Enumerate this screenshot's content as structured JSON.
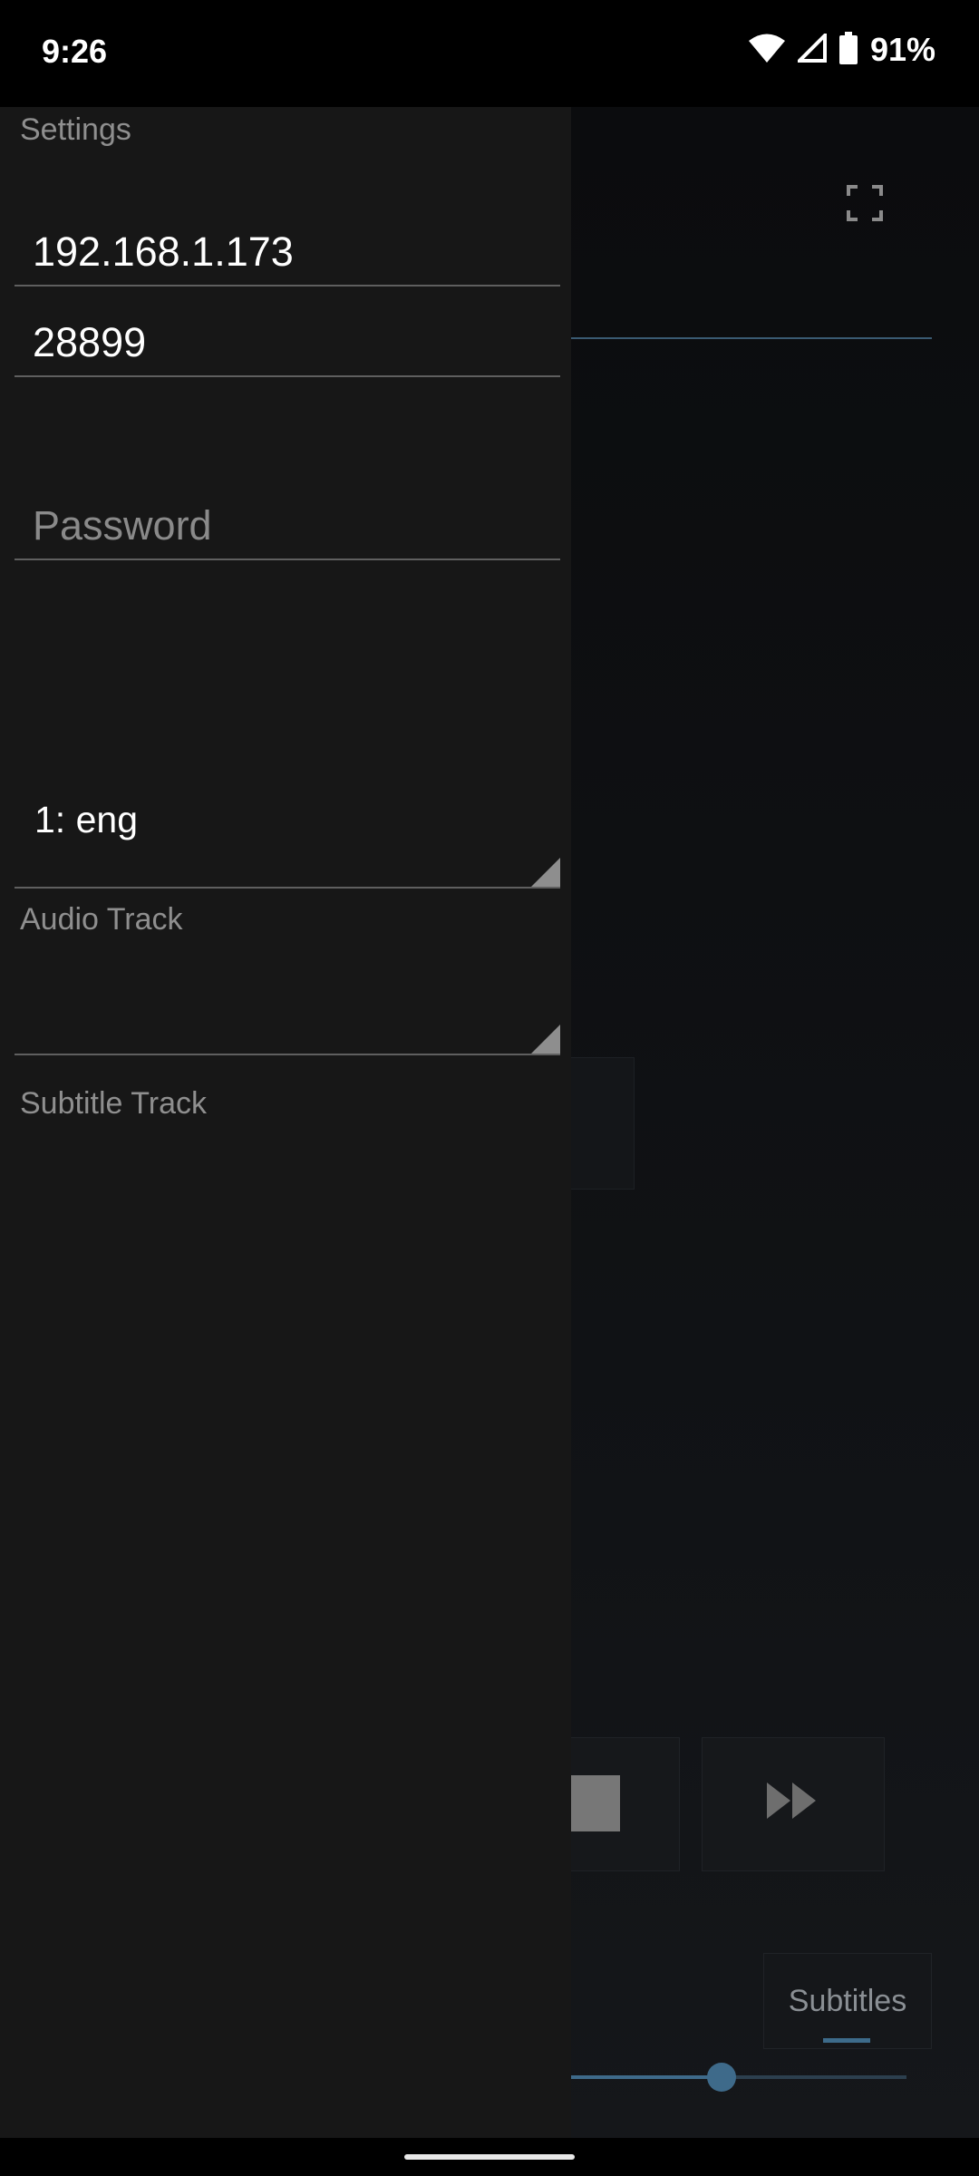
{
  "status_bar": {
    "time": "9:26",
    "battery_percent": "91%",
    "icons": [
      "wifi-icon",
      "cell-signal-icon",
      "battery-icon"
    ]
  },
  "drawer": {
    "title": "Settings",
    "host": {
      "value": "192.168.1.173"
    },
    "port": {
      "value": "28899"
    },
    "password": {
      "placeholder": "Password",
      "value": ""
    },
    "audio_track": {
      "value": "1: eng",
      "label": "Audio Track"
    },
    "subtitle_track": {
      "value": "",
      "label": "Subtitle Track"
    }
  },
  "background_app": {
    "icons": [
      "fullscreen-icon",
      "stop-icon",
      "fast-forward-icon"
    ],
    "subtitles_button": "Subtitles",
    "seek_progress": 0.45
  },
  "colors": {
    "drawer_bg": "#171717",
    "accent": "#3e6a8a"
  }
}
